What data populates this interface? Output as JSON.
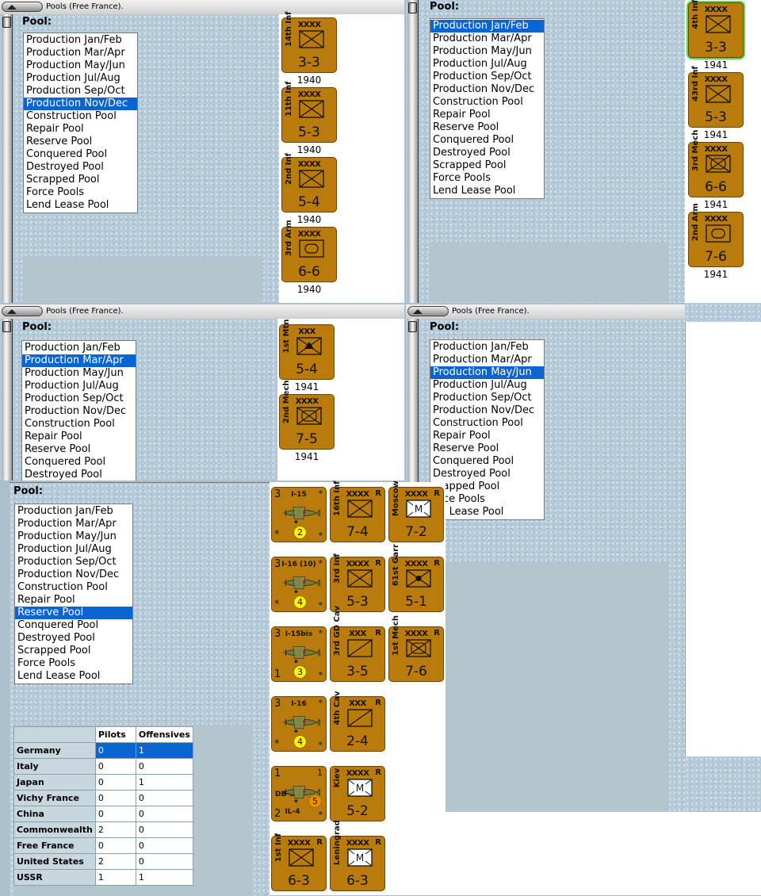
{
  "windows": {
    "top_left": {
      "title": "Pools (Free France).",
      "pool_label": "Pool:",
      "list": [
        "Production Jan/Feb",
        "Production Mar/Apr",
        "Production May/Jun",
        "Production Jul/Aug",
        "Production Sep/Oct",
        "Production Nov/Dec",
        "Construction Pool",
        "Repair Pool",
        "Reserve Pool",
        "Conquered Pool",
        "Destroyed Pool",
        "Scrapped Pool",
        "Force Pools",
        "Lend Lease Pool"
      ],
      "selected": "Production Nov/Dec",
      "units": [
        {
          "size": "XXXX",
          "name": "14th Inf",
          "factor": "3-3",
          "year": "1940",
          "symbol": "infantry"
        },
        {
          "size": "XXXX",
          "name": "11th Inf",
          "factor": "5-3",
          "year": "1940",
          "symbol": "infantry"
        },
        {
          "size": "XXXX",
          "name": "2nd Inf",
          "factor": "5-4",
          "year": "1940",
          "symbol": "infantry"
        },
        {
          "size": "XXXX",
          "name": "3rd Arm",
          "factor": "6-6",
          "year": "1940",
          "symbol": "armor"
        }
      ]
    },
    "top_right": {
      "pool_label": "Pool:",
      "list": [
        "Production Jan/Feb",
        "Production Mar/Apr",
        "Production May/Jun",
        "Production Jul/Aug",
        "Production Sep/Oct",
        "Production Nov/Dec",
        "Construction Pool",
        "Repair Pool",
        "Reserve Pool",
        "Conquered Pool",
        "Destroyed Pool",
        "Scrapped Pool",
        "Force Pools",
        "Lend Lease Pool"
      ],
      "selected": "Production Jan/Feb",
      "units": [
        {
          "size": "XXXX",
          "name": "4th Inf",
          "factor": "3-3",
          "year": "1941",
          "symbol": "infantry",
          "highlight": true
        },
        {
          "size": "XXXX",
          "name": "43rd Inf",
          "factor": "5-3",
          "year": "1941",
          "symbol": "infantry"
        },
        {
          "size": "XXXX",
          "name": "3rd Mech",
          "factor": "6-6",
          "year": "1941",
          "symbol": "mech"
        },
        {
          "size": "XXXX",
          "name": "2nd Arm",
          "factor": "7-6",
          "year": "1941",
          "symbol": "armor"
        }
      ]
    },
    "mid_left": {
      "title": "Pools (Free France).",
      "pool_label": "Pool:",
      "list": [
        "Production Jan/Feb",
        "Production Mar/Apr",
        "Production May/Jun",
        "Production Jul/Aug",
        "Production Sep/Oct",
        "Production Nov/Dec",
        "Construction Pool",
        "Repair Pool",
        "Reserve Pool",
        "Conquered Pool",
        "Destroyed Pool"
      ],
      "selected": "Production Mar/Apr",
      "units": [
        {
          "size": "XXX",
          "name": "1st Mtn",
          "factor": "5-4",
          "year": "1941",
          "symbol": "mountain"
        },
        {
          "size": "XXXX",
          "name": "2nd Mech",
          "factor": "7-5",
          "year": "1941",
          "symbol": "mech"
        }
      ]
    },
    "mid_right": {
      "title": "Pools (Free France).",
      "pool_label": "Pool:",
      "list": [
        "Production Jan/Feb",
        "Production Mar/Apr",
        "Production May/Jun",
        "Production Jul/Aug",
        "Production Sep/Oct",
        "Production Nov/Dec",
        "Construction Pool",
        "Repair Pool",
        "Reserve Pool",
        "Conquered Pool",
        "Destroyed Pool",
        "Scrapped Pool",
        "Force Pools",
        "Lend Lease Pool"
      ],
      "list_visible_tail": [
        "crapped Pool",
        "orce Pools",
        "nd Lease Pool"
      ],
      "selected": "Production May/Jun"
    },
    "bottom": {
      "pool_label": "Pool:",
      "list": [
        "Production Jan/Feb",
        "Production Mar/Apr",
        "Production May/Jun",
        "Production Jul/Aug",
        "Production Sep/Oct",
        "Production Nov/Dec",
        "Construction Pool",
        "Repair Pool",
        "Reserve Pool",
        "Conquered Pool",
        "Destroyed Pool",
        "Scrapped Pool",
        "Force Pools",
        "Lend Lease Pool"
      ],
      "selected": "Reserve Pool",
      "table": {
        "headers": [
          "",
          "Pilots",
          "Offensives"
        ],
        "rows": [
          {
            "nation": "Germany",
            "pilots": "0",
            "offensives": "1"
          },
          {
            "nation": "Italy",
            "pilots": "0",
            "offensives": "0"
          },
          {
            "nation": "Japan",
            "pilots": "0",
            "offensives": "1"
          },
          {
            "nation": "Vichy France",
            "pilots": "0",
            "offensives": "0"
          },
          {
            "nation": "China",
            "pilots": "0",
            "offensives": "0"
          },
          {
            "nation": "Commonwealth",
            "pilots": "2",
            "offensives": "0"
          },
          {
            "nation": "Free France",
            "pilots": "0",
            "offensives": "0"
          },
          {
            "nation": "United States",
            "pilots": "2",
            "offensives": "0"
          },
          {
            "nation": "USSR",
            "pilots": "1",
            "offensives": "1"
          }
        ]
      },
      "air": [
        {
          "type": "I-15",
          "tl": "3",
          "tr": "*",
          "bl": "*",
          "br": "*",
          "badge": "2"
        },
        {
          "type": "I-16 (10)",
          "tl": "3",
          "tr": "*",
          "bl": "*",
          "br": "*",
          "badge": "4"
        },
        {
          "type": "I-15bis",
          "tl": "3",
          "tr": "*",
          "bl": "1",
          "br": "*",
          "badge": "3"
        },
        {
          "type": "I-16",
          "tl": "3",
          "tr": "*",
          "bl": "*",
          "br": "*",
          "badge": "4"
        },
        {
          "type": "DB-3",
          "type2": "IL-4",
          "tl": "1",
          "tr": "1",
          "bl": "2",
          "br": "*",
          "badge": "5"
        }
      ],
      "land": [
        {
          "size": "XXXX",
          "name": "1st Inf",
          "factor": "6-3",
          "symbol": "infantry",
          "res": "R"
        },
        {
          "size": "XXXX",
          "name": "16th Inf",
          "factor": "7-4",
          "symbol": "infantry",
          "res": "R"
        },
        {
          "size": "XXXX",
          "name": "3rd Inf",
          "factor": "5-3",
          "symbol": "infantry",
          "res": "R"
        },
        {
          "size": "XXX",
          "name": "3rd GD Cav",
          "factor": "3-5",
          "symbol": "cavalry",
          "res": "R"
        },
        {
          "size": "XXX",
          "name": "4th Cav",
          "factor": "2-4",
          "symbol": "cavalry",
          "res": "R"
        },
        {
          "size": "XXXX",
          "name": "Kiev",
          "factor": "5-2",
          "symbol": "militia",
          "res": "R"
        },
        {
          "size": "XXXX",
          "name": "Leningrad",
          "factor": "6-3",
          "symbol": "militia",
          "res": "R"
        },
        {
          "size": "XXXX",
          "name": "Moscow",
          "factor": "7-2",
          "symbol": "militia",
          "res": "R"
        },
        {
          "size": "XXXX",
          "name": "61st Garr",
          "factor": "5-1",
          "symbol": "garrison",
          "res": "R"
        },
        {
          "size": "XXXX",
          "name": "1st Mech",
          "factor": "7-6",
          "symbol": "mech",
          "res": "R"
        }
      ]
    }
  }
}
